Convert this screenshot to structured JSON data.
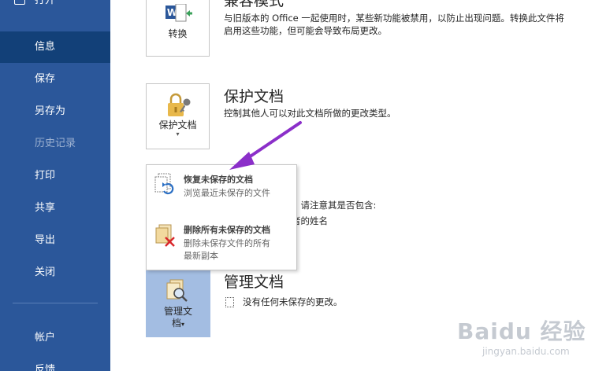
{
  "sidebar": {
    "top_item": "打开",
    "items": [
      {
        "label": "信息"
      },
      {
        "label": "保存"
      },
      {
        "label": "另存为"
      },
      {
        "label": "历史记录"
      },
      {
        "label": "打印"
      },
      {
        "label": "共享"
      },
      {
        "label": "导出"
      },
      {
        "label": "关闭"
      },
      {
        "label": "帐户"
      },
      {
        "label": "反馈"
      }
    ]
  },
  "compat": {
    "title": "兼容模式",
    "button_label": "转换",
    "desc_line1": "与旧版本的 Office 一起使用时，某些新功能被禁用，以防止出现问题。转换此文件将",
    "desc_line2": "启用这些功能，但可能会导致布局更改。"
  },
  "protect": {
    "title": "保护文档",
    "button_label": "保护文档",
    "desc": "控制其他人可以对此文档所做的更改类型。"
  },
  "inspect": {
    "partial_line1": "，请注意其是否包含:",
    "partial_line2": "者的姓名"
  },
  "popup": {
    "recover": {
      "title": "恢复未保存的文档",
      "desc": "浏览最近未保存的文件"
    },
    "delete": {
      "title": "删除所有未保存的文档",
      "desc_line1": "删除未保存文件的所有",
      "desc_line2": "最新副本"
    }
  },
  "manage": {
    "title": "管理文档",
    "button_line1": "管理文",
    "button_line2": "档",
    "desc": "没有任何未保存的更改。"
  },
  "watermark": {
    "brand": "Baidu 经验",
    "url": "jingyan.baidu.com"
  },
  "colors": {
    "sidebar": "#2b579a",
    "active": "#124078",
    "arrow": "#8b2fc9",
    "manage_card": "#a3bde2"
  }
}
